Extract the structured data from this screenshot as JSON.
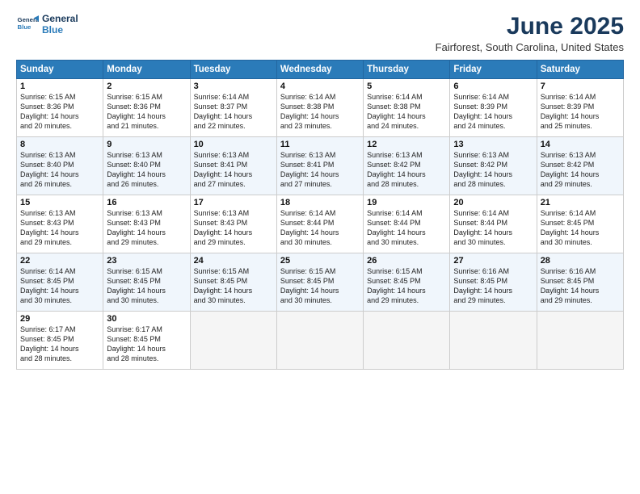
{
  "logo": {
    "line1": "General",
    "line2": "Blue"
  },
  "title": "June 2025",
  "location": "Fairforest, South Carolina, United States",
  "days_header": [
    "Sunday",
    "Monday",
    "Tuesday",
    "Wednesday",
    "Thursday",
    "Friday",
    "Saturday"
  ],
  "weeks": [
    [
      {
        "day": "1",
        "sunrise": "6:15 AM",
        "sunset": "8:36 PM",
        "daylight": "14 hours and 20 minutes."
      },
      {
        "day": "2",
        "sunrise": "6:15 AM",
        "sunset": "8:36 PM",
        "daylight": "14 hours and 21 minutes."
      },
      {
        "day": "3",
        "sunrise": "6:14 AM",
        "sunset": "8:37 PM",
        "daylight": "14 hours and 22 minutes."
      },
      {
        "day": "4",
        "sunrise": "6:14 AM",
        "sunset": "8:38 PM",
        "daylight": "14 hours and 23 minutes."
      },
      {
        "day": "5",
        "sunrise": "6:14 AM",
        "sunset": "8:38 PM",
        "daylight": "14 hours and 24 minutes."
      },
      {
        "day": "6",
        "sunrise": "6:14 AM",
        "sunset": "8:39 PM",
        "daylight": "14 hours and 24 minutes."
      },
      {
        "day": "7",
        "sunrise": "6:14 AM",
        "sunset": "8:39 PM",
        "daylight": "14 hours and 25 minutes."
      }
    ],
    [
      {
        "day": "8",
        "sunrise": "6:13 AM",
        "sunset": "8:40 PM",
        "daylight": "14 hours and 26 minutes."
      },
      {
        "day": "9",
        "sunrise": "6:13 AM",
        "sunset": "8:40 PM",
        "daylight": "14 hours and 26 minutes."
      },
      {
        "day": "10",
        "sunrise": "6:13 AM",
        "sunset": "8:41 PM",
        "daylight": "14 hours and 27 minutes."
      },
      {
        "day": "11",
        "sunrise": "6:13 AM",
        "sunset": "8:41 PM",
        "daylight": "14 hours and 27 minutes."
      },
      {
        "day": "12",
        "sunrise": "6:13 AM",
        "sunset": "8:42 PM",
        "daylight": "14 hours and 28 minutes."
      },
      {
        "day": "13",
        "sunrise": "6:13 AM",
        "sunset": "8:42 PM",
        "daylight": "14 hours and 28 minutes."
      },
      {
        "day": "14",
        "sunrise": "6:13 AM",
        "sunset": "8:42 PM",
        "daylight": "14 hours and 29 minutes."
      }
    ],
    [
      {
        "day": "15",
        "sunrise": "6:13 AM",
        "sunset": "8:43 PM",
        "daylight": "14 hours and 29 minutes."
      },
      {
        "day": "16",
        "sunrise": "6:13 AM",
        "sunset": "8:43 PM",
        "daylight": "14 hours and 29 minutes."
      },
      {
        "day": "17",
        "sunrise": "6:13 AM",
        "sunset": "8:43 PM",
        "daylight": "14 hours and 29 minutes."
      },
      {
        "day": "18",
        "sunrise": "6:14 AM",
        "sunset": "8:44 PM",
        "daylight": "14 hours and 30 minutes."
      },
      {
        "day": "19",
        "sunrise": "6:14 AM",
        "sunset": "8:44 PM",
        "daylight": "14 hours and 30 minutes."
      },
      {
        "day": "20",
        "sunrise": "6:14 AM",
        "sunset": "8:44 PM",
        "daylight": "14 hours and 30 minutes."
      },
      {
        "day": "21",
        "sunrise": "6:14 AM",
        "sunset": "8:45 PM",
        "daylight": "14 hours and 30 minutes."
      }
    ],
    [
      {
        "day": "22",
        "sunrise": "6:14 AM",
        "sunset": "8:45 PM",
        "daylight": "14 hours and 30 minutes."
      },
      {
        "day": "23",
        "sunrise": "6:15 AM",
        "sunset": "8:45 PM",
        "daylight": "14 hours and 30 minutes."
      },
      {
        "day": "24",
        "sunrise": "6:15 AM",
        "sunset": "8:45 PM",
        "daylight": "14 hours and 30 minutes."
      },
      {
        "day": "25",
        "sunrise": "6:15 AM",
        "sunset": "8:45 PM",
        "daylight": "14 hours and 30 minutes."
      },
      {
        "day": "26",
        "sunrise": "6:15 AM",
        "sunset": "8:45 PM",
        "daylight": "14 hours and 29 minutes."
      },
      {
        "day": "27",
        "sunrise": "6:16 AM",
        "sunset": "8:45 PM",
        "daylight": "14 hours and 29 minutes."
      },
      {
        "day": "28",
        "sunrise": "6:16 AM",
        "sunset": "8:45 PM",
        "daylight": "14 hours and 29 minutes."
      }
    ],
    [
      {
        "day": "29",
        "sunrise": "6:17 AM",
        "sunset": "8:45 PM",
        "daylight": "14 hours and 28 minutes."
      },
      {
        "day": "30",
        "sunrise": "6:17 AM",
        "sunset": "8:45 PM",
        "daylight": "14 hours and 28 minutes."
      },
      null,
      null,
      null,
      null,
      null
    ]
  ],
  "labels": {
    "sunrise": "Sunrise:",
    "sunset": "Sunset:",
    "daylight": "Daylight:"
  }
}
